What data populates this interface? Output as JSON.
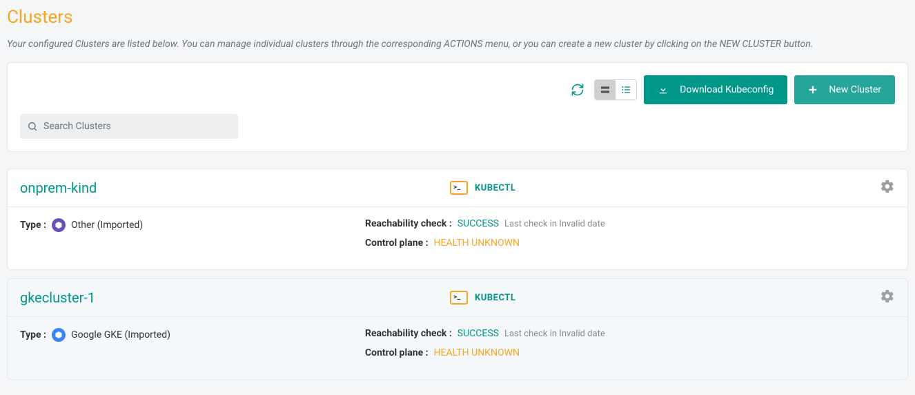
{
  "page": {
    "title": "Clusters",
    "subtitle": "Your configured Clusters are listed below. You can manage individual clusters through the corresponding ACTIONS menu, or you can create a new cluster by clicking on the NEW CLUSTER button."
  },
  "toolbar": {
    "download_label": "Download Kubeconfig",
    "new_cluster_label": "New Cluster",
    "search_placeholder": "Search Clusters"
  },
  "labels": {
    "type": "Type :",
    "reachability": "Reachability check :",
    "control_plane": "Control plane :",
    "kubectl": "KUBECTL"
  },
  "clusters": [
    {
      "name": "onprem-kind",
      "type_value": "Other (Imported)",
      "type_icon": "k8s-wheel-icon",
      "type_color": "purple",
      "reachability_status": "SUCCESS",
      "reachability_meta": "Last check in Invalid date",
      "control_plane_status": "HEALTH UNKNOWN",
      "tinted": false
    },
    {
      "name": "gkecluster-1",
      "type_value": "Google GKE (Imported)",
      "type_icon": "gke-hex-icon",
      "type_color": "blue",
      "reachability_status": "SUCCESS",
      "reachability_meta": "Last check in Invalid date",
      "control_plane_status": "HEALTH UNKNOWN",
      "tinted": true
    }
  ]
}
